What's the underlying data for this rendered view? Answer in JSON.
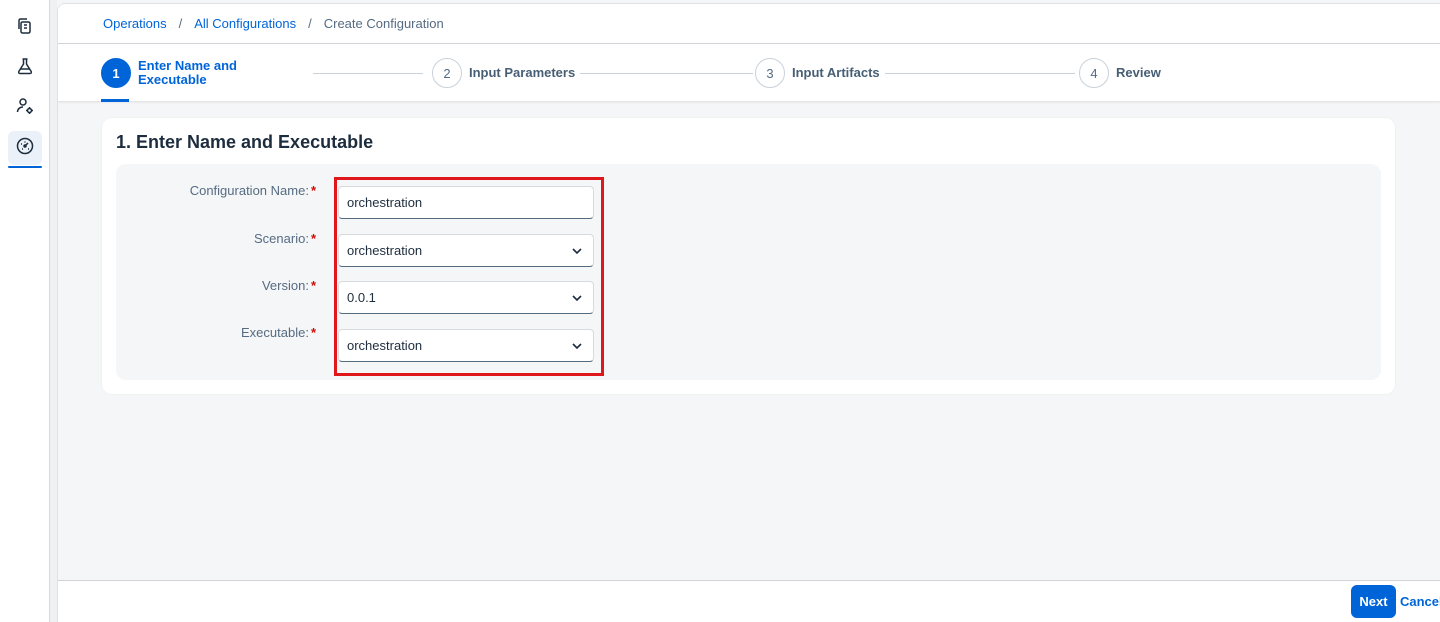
{
  "rail": {
    "items": [
      {
        "icon": "copy-documents-icon"
      },
      {
        "icon": "lab-flask-icon"
      },
      {
        "icon": "user-settings-icon"
      },
      {
        "icon": "dashboard-gauge-icon",
        "active": true
      }
    ]
  },
  "breadcrumb": {
    "items": [
      "Operations",
      "All Configurations"
    ],
    "separator": "/",
    "current": "Create Configuration"
  },
  "wizard": {
    "steps": [
      {
        "number": "1",
        "label": "Enter Name and Executable",
        "active": true
      },
      {
        "number": "2",
        "label": "Input Parameters"
      },
      {
        "number": "3",
        "label": "Input Artifacts"
      },
      {
        "number": "4",
        "label": "Review"
      }
    ]
  },
  "section": {
    "title": "1. Enter Name and Executable"
  },
  "form": {
    "required_marker": "*",
    "configuration_name": {
      "label": "Configuration Name:",
      "value": "orchestration"
    },
    "scenario": {
      "label": "Scenario:",
      "value": "orchestration"
    },
    "version": {
      "label": "Version:",
      "value": "0.0.1"
    },
    "executable": {
      "label": "Executable:",
      "value": "orchestration"
    }
  },
  "footer": {
    "next_label": "Next",
    "cancel_label": "Cancel"
  },
  "colors": {
    "accent": "#0064d9",
    "highlight": "#e0161d",
    "required": "#d20a0a"
  }
}
